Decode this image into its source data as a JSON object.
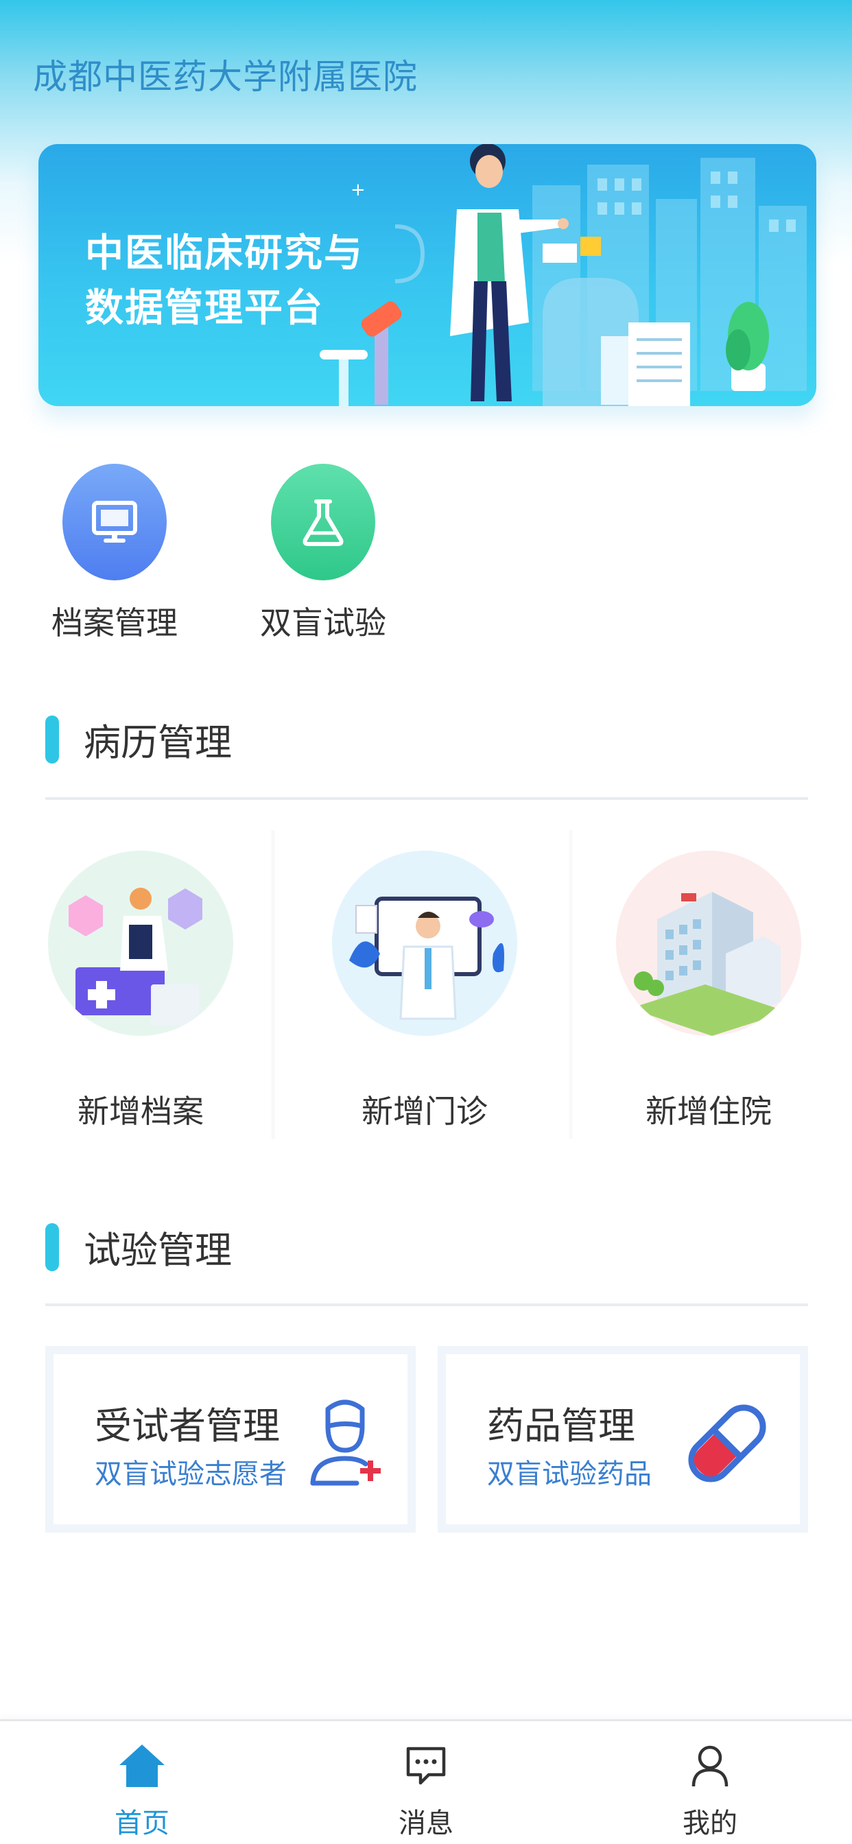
{
  "header": {
    "hospital_name": "成都中医药大学附属医院"
  },
  "banner": {
    "line1": "中医临床研究与",
    "line2": "数据管理平台"
  },
  "quick_actions": [
    {
      "label": "档案管理",
      "icon": "monitor-icon",
      "color": "#5b8ff3"
    },
    {
      "label": "双盲试验",
      "icon": "flask-icon",
      "color": "#3bd39a"
    }
  ],
  "sections": {
    "records": {
      "title": "病历管理",
      "items": [
        {
          "label": "新增档案",
          "icon": "add-record-illustration"
        },
        {
          "label": "新增门诊",
          "icon": "outpatient-doctor-illustration"
        },
        {
          "label": "新增住院",
          "icon": "hospital-building-illustration"
        }
      ]
    },
    "trials": {
      "title": "试验管理",
      "items": [
        {
          "title": "受试者管理",
          "subtitle": "双盲试验志愿者",
          "icon": "add-person-icon"
        },
        {
          "title": "药品管理",
          "subtitle": "双盲试验药品",
          "icon": "pill-icon"
        }
      ]
    }
  },
  "tabbar": {
    "items": [
      {
        "label": "首页",
        "icon": "home-icon",
        "active": true
      },
      {
        "label": "消息",
        "icon": "message-icon",
        "active": false
      },
      {
        "label": "我的",
        "icon": "user-icon",
        "active": false
      }
    ],
    "active_color": "#1f95d8"
  }
}
